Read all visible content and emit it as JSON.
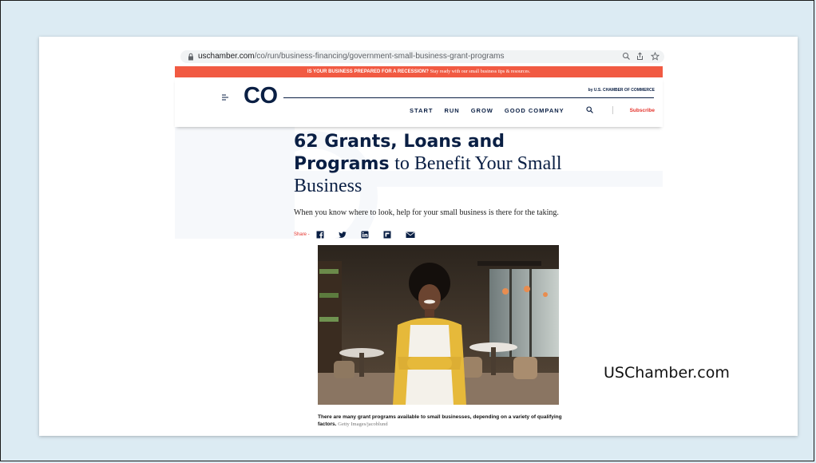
{
  "browser": {
    "url_domain": "uschamber.com",
    "url_path": "/co/run/business-financing/government-small-business-grant-programs",
    "icons": [
      "lock-icon",
      "zoom-icon",
      "share-icon",
      "bookmark-star-icon"
    ]
  },
  "banner": {
    "bold_text": "IS YOUR BUSINESS PREPARED FOR A RECESSION?",
    "rest_text": "Stay ready with our small business tips & resources."
  },
  "header": {
    "logo": "CO",
    "by_line": "by U.S. CHAMBER OF COMMERCE",
    "nav": [
      "START",
      "RUN",
      "GROW",
      "GOOD COMPANY"
    ],
    "subscribe": "Subscribe"
  },
  "article": {
    "headline_bold": "62 Grants, Loans and Programs",
    "headline_regular": "to Benefit Your Small Business",
    "subhead": "When you know where to look, help for your small business is there for the taking.",
    "share_label": "Share -",
    "share_icons": [
      "facebook-icon",
      "twitter-icon",
      "linkedin-icon",
      "flipboard-icon",
      "email-icon"
    ],
    "caption": "There are many grant programs available to small businesses, depending on a variety of qualifying factors.",
    "caption_credit": "Getty Images/jacoblund"
  },
  "slide": {
    "side_label": "USChamber.com"
  },
  "colors": {
    "banner": "#f15a42",
    "navy": "#0a1f44",
    "accent_red": "#e4322b",
    "slide_bg": "#dcebf3"
  }
}
